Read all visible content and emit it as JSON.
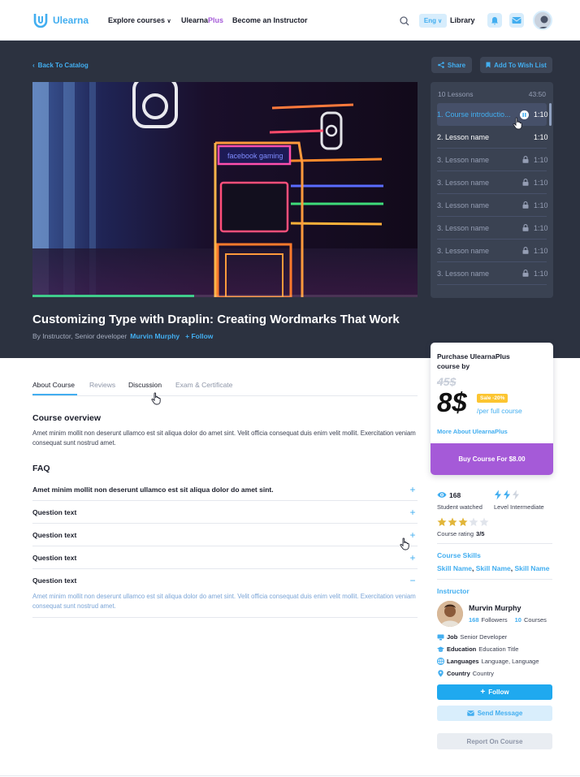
{
  "nav": {
    "logo": "Ulearna",
    "explore": "Explore courses",
    "plus_base": "Ulearna",
    "plus_accent": "Plus",
    "instructor": "Become an Instructor",
    "lang": "Eng",
    "library": "Library"
  },
  "hero": {
    "back": "Back To Catalog",
    "share": "Share",
    "wishlist": "Add To Wish List",
    "video_progress": 0.42,
    "title": "Customizing Type with Draplin: Creating Wordmarks That Work",
    "byline": "By Instructor, Senior developer",
    "instructor_link": "Murvin Murphy",
    "follow": "Follow",
    "sign_text": "facebook gaming"
  },
  "lessons": {
    "count": "10 Lessons",
    "total": "43:50",
    "items": [
      {
        "title": "1. Course introductio...",
        "duration": "1:10"
      },
      {
        "title": "2. Lesson name",
        "duration": "1:10"
      },
      {
        "title": "3. Lesson name",
        "duration": "1:10"
      },
      {
        "title": "3. Lesson name",
        "duration": "1:10"
      },
      {
        "title": "3. Lesson name",
        "duration": "1:10"
      },
      {
        "title": "3. Lesson name",
        "duration": "1:10"
      },
      {
        "title": "3. Lesson name",
        "duration": "1:10"
      },
      {
        "title": "3. Lesson name",
        "duration": "1:10"
      }
    ]
  },
  "tabs": [
    "About Course",
    "Reviews",
    "Discussion",
    "Exam & Certificate"
  ],
  "overview": {
    "heading": "Course overview",
    "text": "Amet minim mollit non deserunt ullamco est sit aliqua dolor do amet sint. Velit officia consequat duis enim velit mollit. Exercitation veniam consequat sunt nostrud amet."
  },
  "faq": {
    "heading": "FAQ",
    "items": [
      {
        "q": "Amet minim mollit non deserunt ullamco est sit aliqua dolor do amet sint.",
        "icon": "+"
      },
      {
        "q": "Question text",
        "icon": "+"
      },
      {
        "q": "Question text",
        "icon": "+"
      },
      {
        "q": "Question text",
        "icon": "+"
      },
      {
        "q": "Question text",
        "icon": "−"
      }
    ],
    "answer": "Amet minim mollit non deserunt ullamco est sit aliqua dolor do amet sint. Velit officia consequat duis enim velit mollit. Exercitation veniam consequat sunt nostrud amet."
  },
  "purchase": {
    "heading_line1": "Purchase UlearnaPlus",
    "heading_line2": "course by",
    "old_price": "45$",
    "price": "8$",
    "badge": "Sale -20%",
    "per": "/per full course",
    "more": "More About UlearnaPlus",
    "buy": "Buy Course For $8.00"
  },
  "stats": {
    "students": "168",
    "students_label": "Student watched",
    "level_label": "Level Intermediate",
    "level": 2,
    "rating": 3,
    "rating_label": "Course rating",
    "rating_value": "3/5"
  },
  "skills": {
    "heading": "Course Skills",
    "items": [
      "Skill Name",
      "Skill Name",
      "Skill Name"
    ]
  },
  "instructor": {
    "heading": "Instructor",
    "name": "Murvin Murphy",
    "followers": "168",
    "followers_label": "Followers",
    "courses": "10",
    "courses_label": "Courses",
    "job_label": "Job",
    "job": "Senior Developer",
    "edu_label": "Education",
    "edu": "Education Title",
    "lang_label": "Languages",
    "lang": "Language, Language",
    "country_label": "Country",
    "country": "Country",
    "follow": "Follow",
    "message": "Send Message",
    "report": "Report On Course"
  },
  "colors": {
    "accent": "#42aef0",
    "purple": "#a55ad8",
    "hero_bg": "#2c3240",
    "progress": "#3fcc8b",
    "badge": "#fcc531"
  }
}
